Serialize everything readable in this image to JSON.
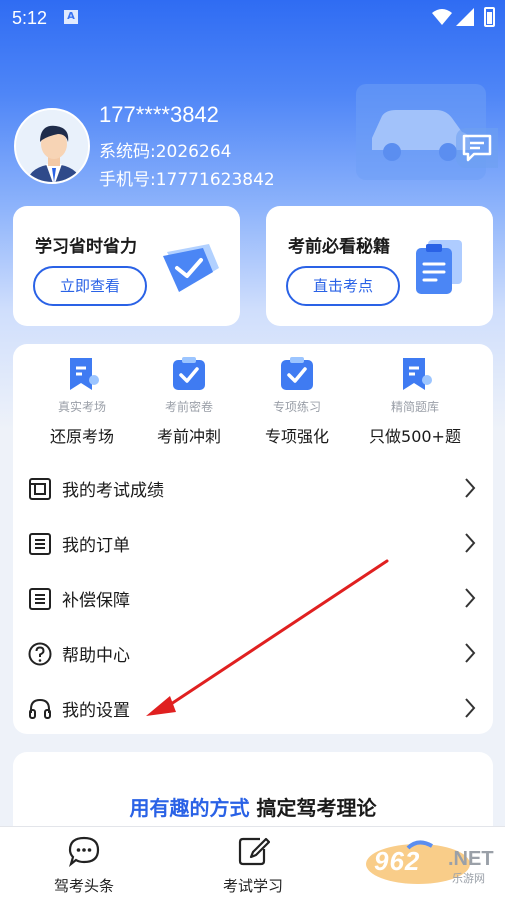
{
  "status_bar": {
    "time": "5:12"
  },
  "profile": {
    "username": "177****3842",
    "system_code_label": "系统码:",
    "system_code": "2026264",
    "phone_label": "手机号:",
    "phone": "17771623842"
  },
  "promos": [
    {
      "title": "学习省时省力",
      "button": "立即查看"
    },
    {
      "title": "考前必看秘籍",
      "button": "直击考点"
    }
  ],
  "features": [
    {
      "sub": "真实考场",
      "label": "还原考场",
      "icon": "bookmark-icon"
    },
    {
      "sub": "考前密卷",
      "label": "考前冲刺",
      "icon": "clipboard-check-icon"
    },
    {
      "sub": "专项练习",
      "label": "专项强化",
      "icon": "clipboard-check-icon"
    },
    {
      "sub": "精简题库",
      "label": "只做500+题",
      "icon": "bookmark-icon"
    }
  ],
  "menu": [
    {
      "label": "我的考试成绩",
      "icon": "score-icon"
    },
    {
      "label": "我的订单",
      "icon": "order-icon"
    },
    {
      "label": "补偿保障",
      "icon": "guarantee-icon"
    },
    {
      "label": "帮助中心",
      "icon": "help-icon"
    },
    {
      "label": "我的设置",
      "icon": "headset-icon"
    }
  ],
  "banner": {
    "highlight": "用有趣的方式",
    "rest": "搞定驾考理论"
  },
  "tabs": [
    {
      "label": "驾考头条",
      "icon": "chat-bubble-icon"
    },
    {
      "label": "考试学习",
      "icon": "edit-icon"
    }
  ],
  "watermark": {
    "brand": "962",
    "suffix": ".NET",
    "sub": "乐游网"
  },
  "colors": {
    "primary": "#2a62e6",
    "accent_light": "#4f86f7",
    "arrow": "#e02020"
  }
}
